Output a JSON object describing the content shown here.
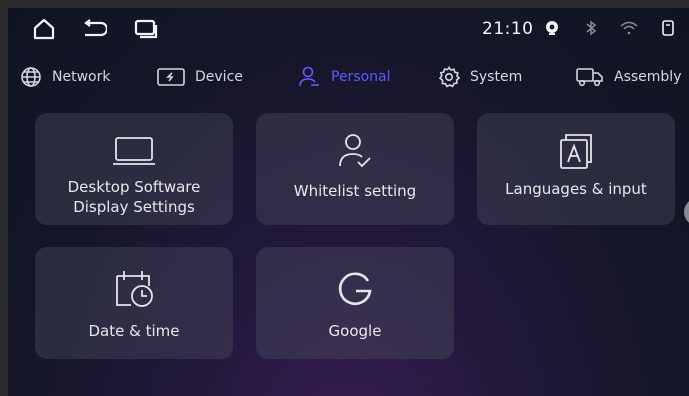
{
  "status_bar": {
    "time": "21:10",
    "icons": [
      "home-icon",
      "back-icon",
      "recents-icon",
      "hotspot-icon",
      "bluetooth-icon",
      "wifi-icon",
      "sim-icon"
    ]
  },
  "tabs": [
    {
      "label": "Network",
      "icon": "globe-icon",
      "active": false
    },
    {
      "label": "Device",
      "icon": "device-icon",
      "active": false
    },
    {
      "label": "Personal",
      "icon": "person-icon",
      "active": true
    },
    {
      "label": "System",
      "icon": "gear-icon",
      "active": false
    },
    {
      "label": "Assembly",
      "icon": "truck-icon",
      "active": false
    }
  ],
  "tiles": [
    {
      "label": "Desktop Software Display Settings",
      "icon": "monitor-icon"
    },
    {
      "label": "Whitelist setting",
      "icon": "user-check-icon"
    },
    {
      "label": "Languages & input",
      "icon": "language-icon"
    },
    {
      "label": "Date & time",
      "icon": "calendar-clock-icon"
    },
    {
      "label": "Google",
      "icon": "google-icon"
    }
  ],
  "colors": {
    "accent": "#5a5cff",
    "tile_bg": "#50526460",
    "text": "#e6e6ea"
  }
}
